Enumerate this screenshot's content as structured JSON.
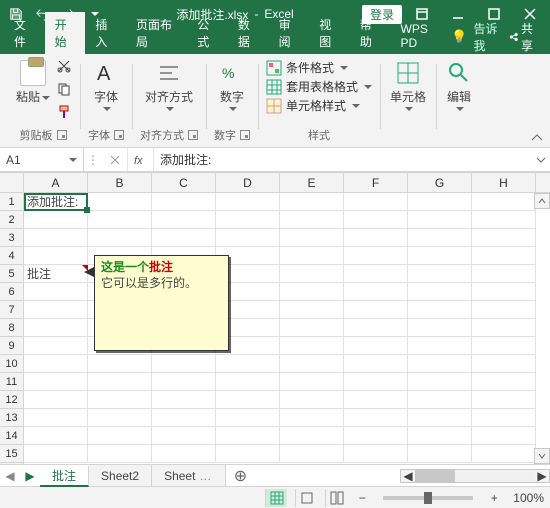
{
  "titlebar": {
    "filename": "添加批注.xlsx",
    "app": "Excel",
    "login": "登录"
  },
  "ribbon": {
    "tabs": {
      "file": "文件",
      "home": "开始",
      "insert": "插入",
      "layout": "页面布局",
      "formulas": "公式",
      "data": "数据",
      "review": "审阅",
      "view": "视图",
      "help": "帮助",
      "wps": "WPS PD"
    },
    "tell_me": "告诉我",
    "share": "共享"
  },
  "groups": {
    "clipboard": {
      "paste": "粘贴",
      "label": "剪贴板"
    },
    "font": {
      "btn": "字体",
      "label": "字体"
    },
    "alignment": {
      "btn": "对齐方式",
      "label": "对齐方式"
    },
    "number": {
      "btn": "数字",
      "label": "数字"
    },
    "styles": {
      "cond": "条件格式",
      "table": "套用表格格式",
      "cell": "单元格样式",
      "label": "样式"
    },
    "cells": {
      "btn": "单元格"
    },
    "editing": {
      "btn": "编辑"
    }
  },
  "namebox": "A1",
  "formula": "添加批注:",
  "columns": [
    "A",
    "B",
    "C",
    "D",
    "E",
    "F",
    "G",
    "H"
  ],
  "row_count": 15,
  "cells": {
    "A1": "添加批注:",
    "A5": "批注"
  },
  "comment": {
    "line1_a": "这是一个",
    "line1_b": "批注",
    "line2": "它可以是多行的。"
  },
  "sheets": {
    "s1": "批注",
    "s2": "Sheet2",
    "s3": "Sheet"
  },
  "status": {
    "zoom": "100%"
  }
}
